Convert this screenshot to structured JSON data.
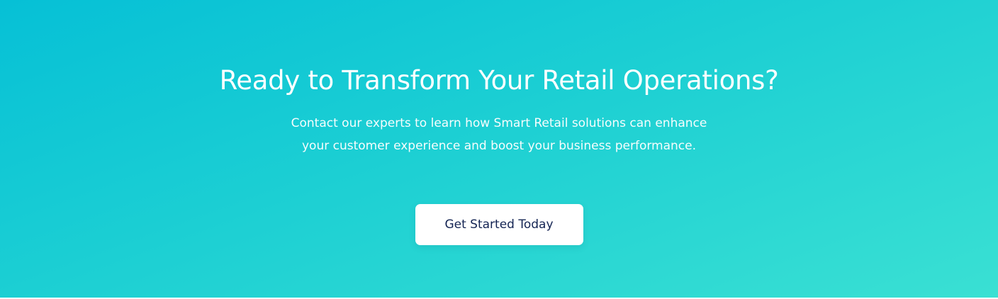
{
  "cta": {
    "title": "Ready to Transform Your Retail Operations?",
    "description_line1": "Contact our experts to learn how Smart Retail solutions can enhance",
    "description_line2": "your customer experience and boost your business performance.",
    "button_label": "Get Started Today"
  },
  "colors": {
    "gradient_start": "#06c0d6",
    "gradient_end": "#3ae0d3",
    "button_background": "#ffffff",
    "button_text": "#142453",
    "heading_text": "#ffffff"
  }
}
